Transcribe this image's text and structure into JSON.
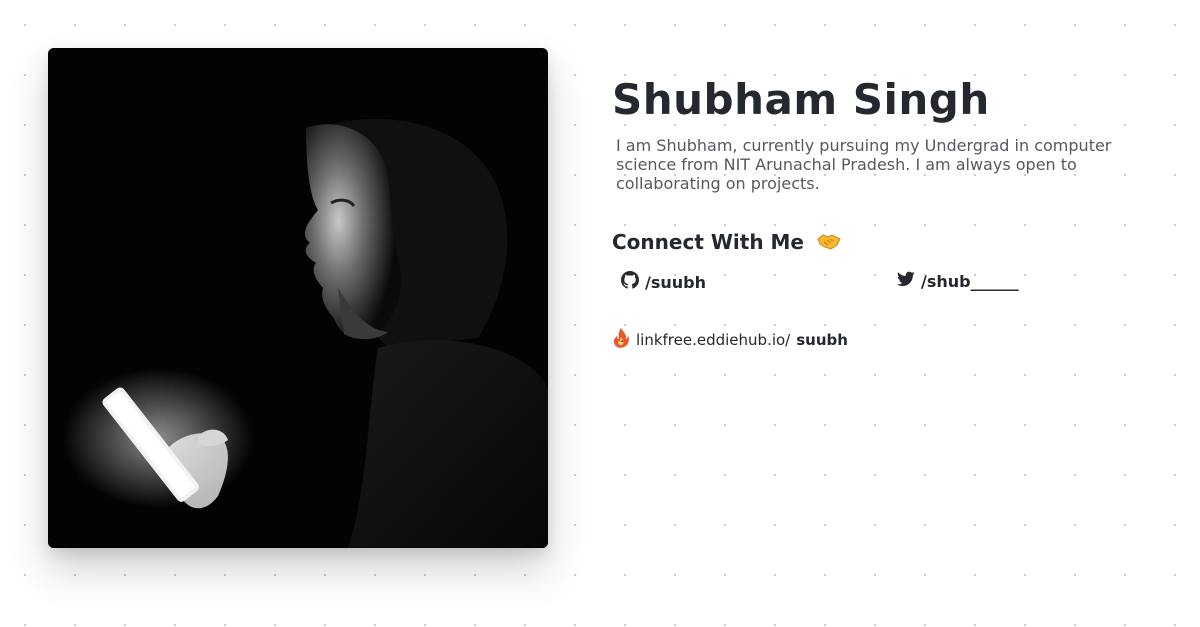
{
  "profile": {
    "name": "Shubham Singh",
    "bio": "I am Shubham, currently pursuing my Undergrad in computer science from NIT Arunachal Pradesh. I am always open to collaborating on projects.",
    "photo_icon": "person-silhouette-with-phone"
  },
  "connect": {
    "heading": "Connect With Me",
    "heading_icon": "handshake-icon"
  },
  "socials": {
    "github": {
      "icon": "github-icon",
      "label": "/suubh"
    },
    "twitter": {
      "icon": "twitter-icon",
      "label": "/shub______"
    }
  },
  "linkfree": {
    "icon": "linkfree-flame-icon",
    "prefix": "linkfree.eddiehub.io/",
    "username": "suubh"
  },
  "colors": {
    "text": "#24292f",
    "muted": "#555a60",
    "background": "#ffffff",
    "dot": "#c9c9c9"
  }
}
